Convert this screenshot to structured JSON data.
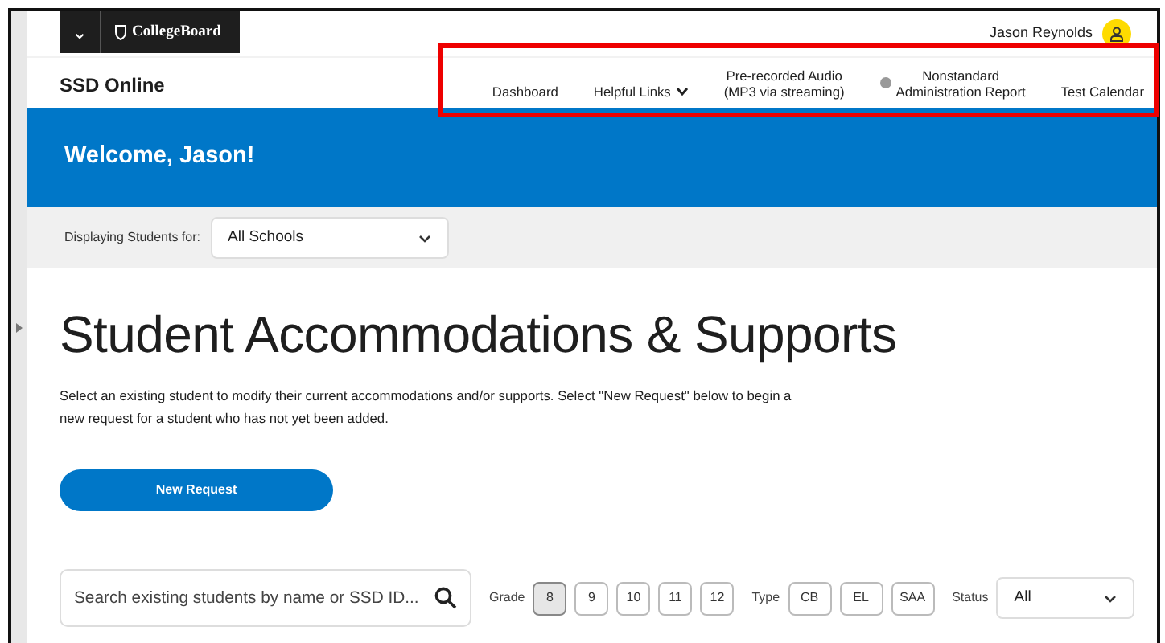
{
  "header": {
    "menu_toggle": "⌄",
    "logo": "CollegeBoard",
    "user_name": "Jason Reynolds"
  },
  "app_title": "SSD Online",
  "nav": [
    {
      "label": "Dashboard",
      "kind": "link"
    },
    {
      "label": "Helpful Links",
      "kind": "dropdown"
    },
    {
      "label": "Pre-recorded Audio\n(MP3 via streaming)",
      "kind": "link"
    },
    {
      "label": "Nonstandard\nAdministration Report",
      "kind": "status"
    },
    {
      "label": "Test Calendar",
      "kind": "link"
    }
  ],
  "welcome": "Welcome, Jason!",
  "filter": {
    "label": "Displaying Students for:",
    "value": "All Schools"
  },
  "heading": "Student Accommodations & Supports",
  "intro": "Select an existing student to modify their current accommodations and/or supports. Select \"New Request\" below to begin a new request for a student who has not yet been added.",
  "new_request": "New Request",
  "search": {
    "placeholder": "Search existing students by name or SSD ID..."
  },
  "grade": {
    "label": "Grade",
    "options": [
      {
        "label": "8",
        "selected": true
      },
      {
        "label": "9",
        "selected": false
      },
      {
        "label": "10",
        "selected": false
      },
      {
        "label": "11",
        "selected": false
      },
      {
        "label": "12",
        "selected": false
      }
    ]
  },
  "type": {
    "label": "Type",
    "options": [
      {
        "label": "CB",
        "selected": false
      },
      {
        "label": "EL",
        "selected": false
      },
      {
        "label": "SAA",
        "selected": false
      }
    ]
  },
  "status": {
    "label": "Status",
    "value": "All"
  }
}
